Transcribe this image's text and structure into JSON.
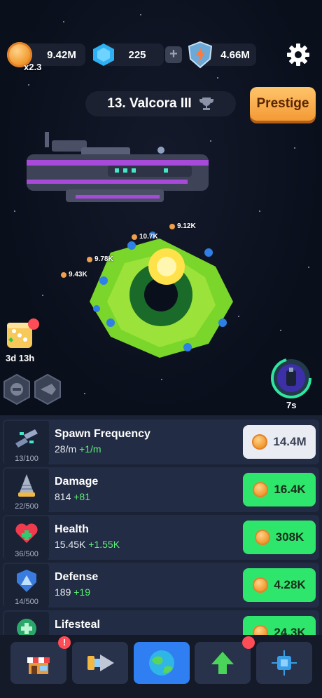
{
  "header": {
    "coins": "9.42M",
    "coin_multiplier": "x2.3",
    "gems": "225",
    "plus_label": "+",
    "energy": "4.66M",
    "settings_icon": "gear-icon"
  },
  "planet": {
    "name": "13. Valcora III",
    "trophy_icon": "trophy-icon"
  },
  "prestige_label": "Prestige",
  "damage_popups": [
    "9.12K",
    "10.7K",
    "9.78K",
    "9.43K"
  ],
  "dice": {
    "timer": "3d 13h"
  },
  "portal": {
    "timer": "7s"
  },
  "upgrades": [
    {
      "name": "Spawn Frequency",
      "level": "13/100",
      "value": "28/m",
      "increment": "+1/m",
      "cost": "14.4M",
      "affordable": false,
      "icon": "ships-icon"
    },
    {
      "name": "Damage",
      "level": "22/500",
      "value": "814",
      "increment": "+81",
      "cost": "16.4K",
      "affordable": true,
      "icon": "drill-icon"
    },
    {
      "name": "Health",
      "level": "36/500",
      "value": "15.45K",
      "increment": "+1.55K",
      "cost": "308K",
      "affordable": true,
      "icon": "heart-icon"
    },
    {
      "name": "Defense",
      "level": "14/500",
      "value": "189",
      "increment": "+19",
      "cost": "4.28K",
      "affordable": true,
      "icon": "shield-icon"
    },
    {
      "name": "Lifesteal",
      "level": "",
      "value": "",
      "increment": "",
      "cost": "24.3K",
      "affordable": true,
      "icon": "lifesteal-icon"
    }
  ],
  "nav": {
    "shop_badge": "!",
    "items": [
      "shop",
      "drill",
      "planet",
      "upgrade",
      "chip"
    ]
  },
  "colors": {
    "background": "#0a0f1c",
    "panel": "#1a2236",
    "affordable": "#2ee66c",
    "prestige": "#f7a942",
    "active_nav": "#2f7ff2"
  }
}
